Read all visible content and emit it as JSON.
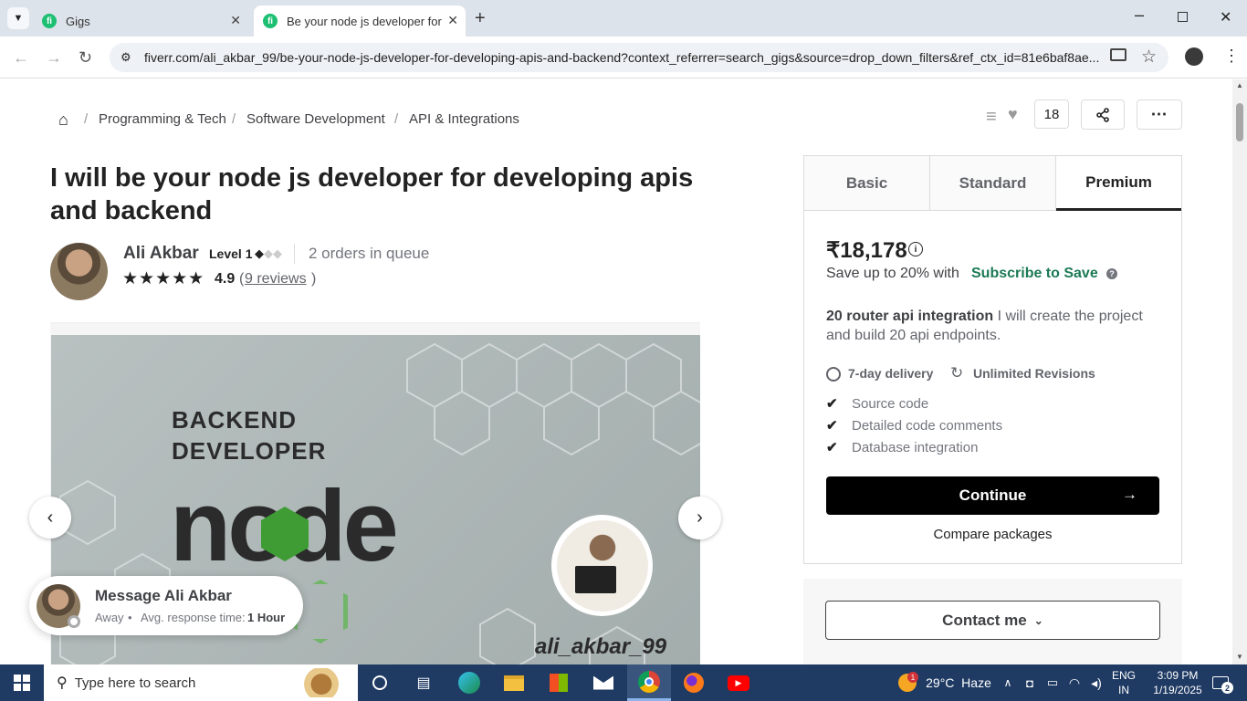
{
  "browser": {
    "tabs": [
      {
        "title": "Gigs",
        "favicon": "fi"
      },
      {
        "title": "Be your node js developer for d",
        "favicon": "fi"
      }
    ],
    "url": "fiverr.com/ali_akbar_99/be-your-node-js-developer-for-developing-apis-and-backend?context_referrer=search_gigs&source=drop_down_filters&ref_ctx_id=81e6baf8ae..."
  },
  "breadcrumb": [
    "Programming & Tech",
    "Software Development",
    "API & Integrations"
  ],
  "actions": {
    "likes": "18"
  },
  "gig": {
    "title": "I will be your node js developer for developing apis and backend",
    "seller_name": "Ali Akbar",
    "level": "Level 1",
    "queue": "2 orders in queue",
    "rating": "4.9",
    "reviews_open": "(",
    "reviews": "9 reviews",
    "reviews_close": ")",
    "image": {
      "headline1": "BACKEND",
      "headline2": "DEVELOPER",
      "logo_text": "node",
      "handle": "ali_akbar_99"
    }
  },
  "message": {
    "title": "Message Ali Akbar",
    "status": "Away",
    "response_label": "Avg. response time:",
    "response_value": "1 Hour"
  },
  "packages": {
    "tabs": [
      "Basic",
      "Standard",
      "Premium"
    ],
    "price": "₹18,178",
    "save_text": "Save up to 20% with",
    "subscribe": "Subscribe to Save",
    "pkg_name": "20 router api integration",
    "pkg_desc": "I will create the project and build 20 api endpoints.",
    "delivery": "7-day delivery",
    "revisions": "Unlimited Revisions",
    "features": [
      "Source code",
      "Detailed code comments",
      "Database integration"
    ],
    "continue": "Continue",
    "compare": "Compare packages",
    "contact": "Contact me"
  },
  "taskbar": {
    "search_placeholder": "Type here to search",
    "weather": "29°C  Haze",
    "lang1": "ENG",
    "lang2": "IN",
    "time": "3:09 PM",
    "date": "1/19/2025",
    "notif": "2",
    "weather_badge": "1"
  },
  "colors": {
    "accent": "#1dbf73",
    "subscribe": "#1b7a55",
    "taskbar": "#1f3a63"
  }
}
